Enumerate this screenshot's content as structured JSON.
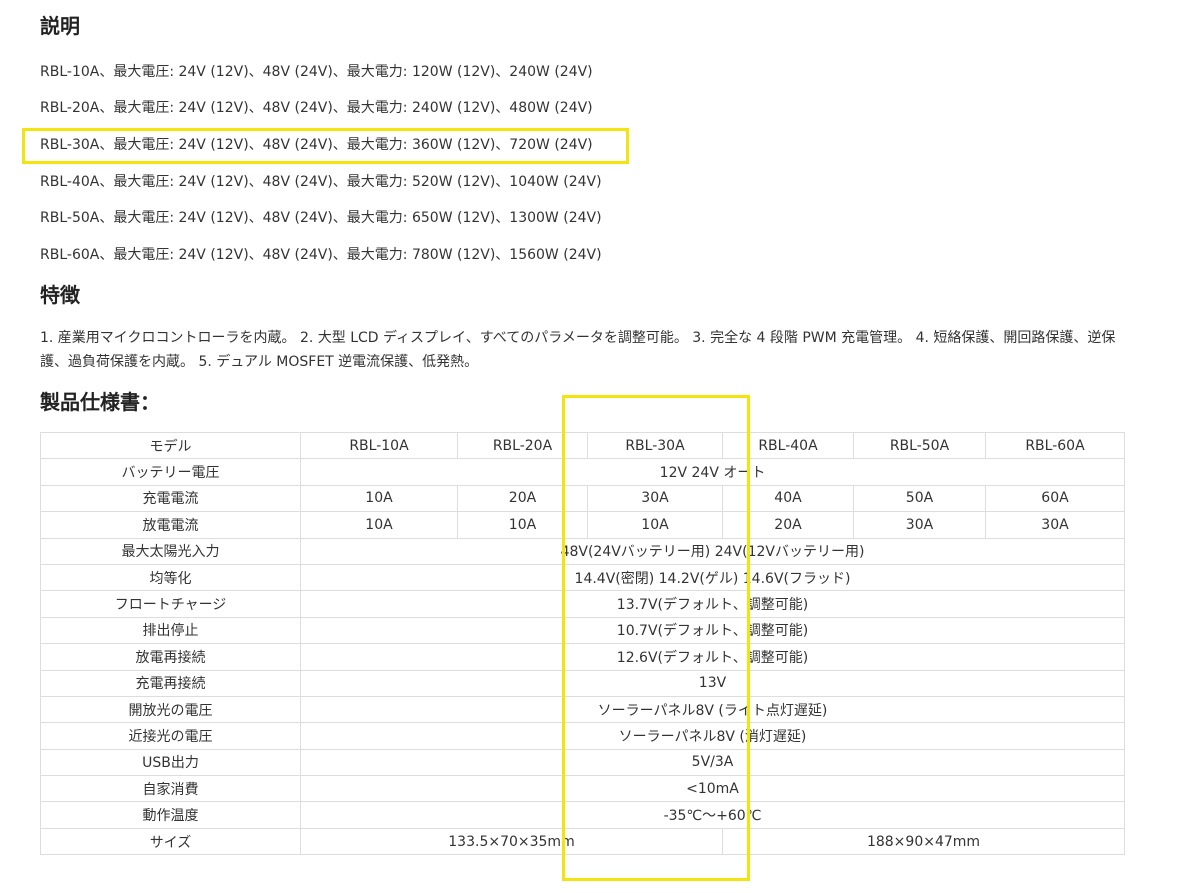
{
  "description": {
    "heading": "説明",
    "lines": [
      "RBL-10A、最大電圧: 24V (12V)、48V (24V)、最大電力: 120W (12V)、240W (24V)",
      "RBL-20A、最大電圧: 24V (12V)、48V (24V)、最大電力: 240W (12V)、480W (24V)",
      "RBL-30A、最大電圧: 24V (12V)、48V (24V)、最大電力: 360W (12V)、720W (24V)",
      "RBL-40A、最大電圧: 24V (12V)、48V (24V)、最大電力: 520W (12V)、1040W (24V)",
      "RBL-50A、最大電圧: 24V (12V)、48V (24V)、最大電力: 650W (12V)、1300W (24V)",
      "RBL-60A、最大電圧: 24V (12V)、48V (24V)、最大電力: 780W (12V)、1560W (24V)"
    ]
  },
  "features": {
    "heading": "特徴",
    "text": "1. 産業用マイクロコントローラを内蔵。 2. 大型 LCD ディスプレイ、すべてのパラメータを調整可能。 3. 完全な 4 段階 PWM 充電管理。 4. 短絡保護、開回路保護、逆保護、過負荷保護を内蔵。 5. デュアル MOSFET 逆電流保護、低発熱。"
  },
  "spec": {
    "heading": "製品仕様書：",
    "header": {
      "label": "モデル",
      "models": [
        "RBL-10A",
        "RBL-20A",
        "RBL-30A",
        "RBL-40A",
        "RBL-50A",
        "RBL-60A"
      ]
    },
    "battery_voltage": {
      "label": "バッテリー電圧",
      "value": "12V 24V オート"
    },
    "charge_current": {
      "label": "充電電流",
      "values": [
        "10A",
        "20A",
        "30A",
        "40A",
        "50A",
        "60A"
      ]
    },
    "discharge_current": {
      "label": "放電電流",
      "values": [
        "10A",
        "10A",
        "10A",
        "20A",
        "30A",
        "30A"
      ]
    },
    "max_solar_input": {
      "label": "最大太陽光入力",
      "value": "48V(24Vバッテリー用) 24V(12Vバッテリー用)"
    },
    "equalization": {
      "label": "均等化",
      "value": "14.4V(密閉) 14.2V(ゲル) 14.6V(フラッド)"
    },
    "float_charge": {
      "label": "フロートチャージ",
      "value": "13.7V(デフォルト、調整可能)"
    },
    "discharge_stop": {
      "label": "排出停止",
      "value": "10.7V(デフォルト、調整可能)"
    },
    "discharge_reconnect": {
      "label": "放電再接続",
      "value": "12.6V(デフォルト、調整可能)"
    },
    "charge_reconnect": {
      "label": "充電再接続",
      "value": "13V"
    },
    "open_light_voltage": {
      "label": "開放光の電圧",
      "value": "ソーラーパネル8V (ライト点灯遅延)"
    },
    "proximity_light_voltage": {
      "label": "近接光の電圧",
      "value": "ソーラーパネル8V (消灯遅延)"
    },
    "usb_output": {
      "label": "USB出力",
      "value": "5V/3A"
    },
    "self_consumption": {
      "label": "自家消費",
      "value": "<10mA"
    },
    "operating_temp": {
      "label": "動作温度",
      "value": "-35℃～+60℃"
    },
    "size": {
      "label": "サイズ",
      "small": "133.5×70×35mm",
      "large": "188×90×47mm"
    }
  },
  "colors": {
    "highlight": "#f2e40c",
    "border": "#dddddd",
    "text": "#333333"
  }
}
